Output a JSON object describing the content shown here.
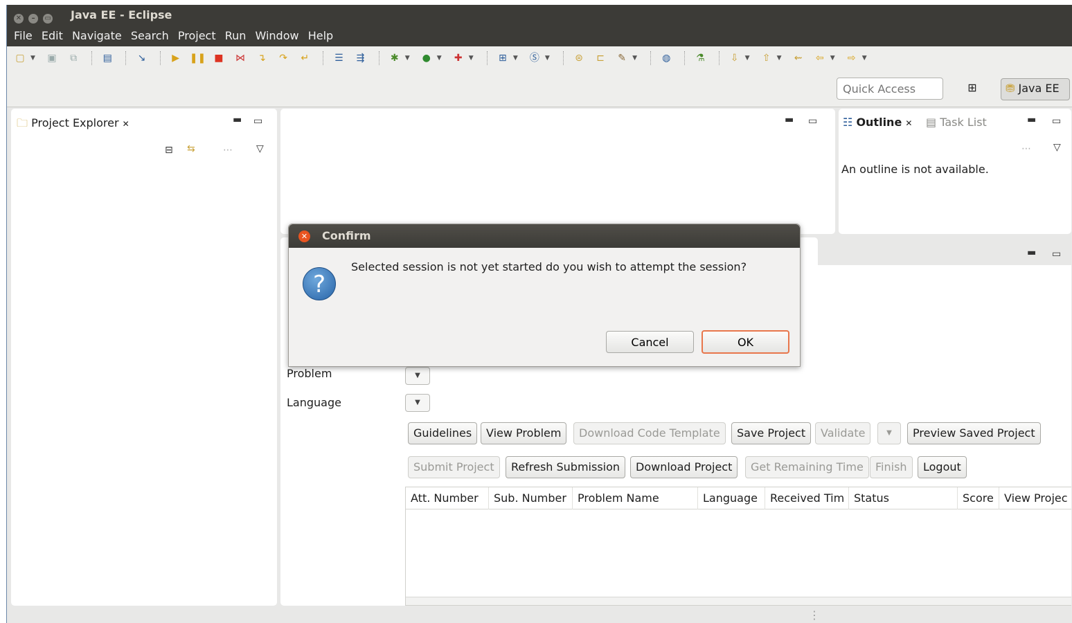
{
  "window": {
    "title": "Java EE - Eclipse"
  },
  "menu": [
    "File",
    "Edit",
    "Navigate",
    "Search",
    "Project",
    "Run",
    "Window",
    "Help"
  ],
  "toolbar": {
    "quick_access_placeholder": "Quick Access",
    "perspective_label": "Java EE"
  },
  "project_explorer": {
    "title": "Project Explorer"
  },
  "outline": {
    "title": "Outline",
    "task_list_tab": "Task List",
    "empty_message": "An outline is not available."
  },
  "form": {
    "problem_label": "Problem",
    "language_label": "Language"
  },
  "buttons_row1": [
    {
      "label": "Guidelines",
      "enabled": true
    },
    {
      "label": "View Problem",
      "enabled": true
    },
    {
      "label": "Download Code Template",
      "enabled": false
    },
    {
      "label": "Save Project",
      "enabled": true
    },
    {
      "label": "Validate",
      "enabled": false
    },
    {
      "label": "Preview Saved Project",
      "enabled": true
    }
  ],
  "buttons_row2": [
    {
      "label": "Submit Project",
      "enabled": false
    },
    {
      "label": "Refresh Submission",
      "enabled": true
    },
    {
      "label": "Download Project",
      "enabled": true
    },
    {
      "label": "Get Remaining Time",
      "enabled": false
    },
    {
      "label": "Finish",
      "enabled": false
    },
    {
      "label": "Logout",
      "enabled": true
    }
  ],
  "table": {
    "columns": [
      "Att. Number",
      "Sub. Number",
      "Problem Name",
      "Language",
      "Received Tim",
      "Status",
      "Score",
      "View Projec"
    ]
  },
  "dialog": {
    "title": "Confirm",
    "message": "Selected session is not yet started do you wish to attempt the session?",
    "cancel_label": "Cancel",
    "ok_label": "OK"
  },
  "colors": {
    "title_bar": "#3c3b37",
    "close_button": "#e95420",
    "ok_border": "#e8764b"
  }
}
